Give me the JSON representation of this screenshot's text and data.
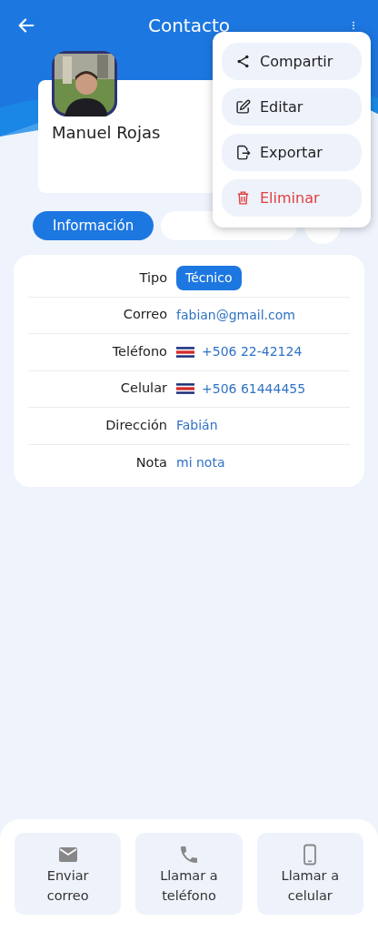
{
  "header": {
    "title": "Contacto"
  },
  "contact": {
    "name": "Manuel Rojas"
  },
  "tabs": [
    {
      "label": "Información",
      "selected": true
    },
    {
      "selected": false
    },
    {
      "selected": false
    }
  ],
  "fields": [
    {
      "label": "Tipo",
      "value": "Técnico",
      "kind": "badge"
    },
    {
      "label": "Correo",
      "value": "fabian@gmail.com",
      "kind": "link"
    },
    {
      "label": "Teléfono",
      "value": "+506 22-42124",
      "kind": "phone"
    },
    {
      "label": "Celular",
      "value": "+506 61444455",
      "kind": "phone"
    },
    {
      "label": "Dirección",
      "value": "Fabián",
      "kind": "link"
    },
    {
      "label": "Nota",
      "value": "mi nota",
      "kind": "link"
    }
  ],
  "actions": [
    {
      "label": "Enviar correo",
      "kind": "mail"
    },
    {
      "label": "Llamar a teléfono",
      "kind": "phone"
    },
    {
      "label": "Llamar a celular",
      "kind": "mobile"
    }
  ],
  "menu": [
    {
      "label": "Compartir",
      "kind": "share"
    },
    {
      "label": "Editar",
      "kind": "edit"
    },
    {
      "label": "Exportar",
      "kind": "export"
    },
    {
      "label": "Eliminar",
      "kind": "delete"
    }
  ]
}
